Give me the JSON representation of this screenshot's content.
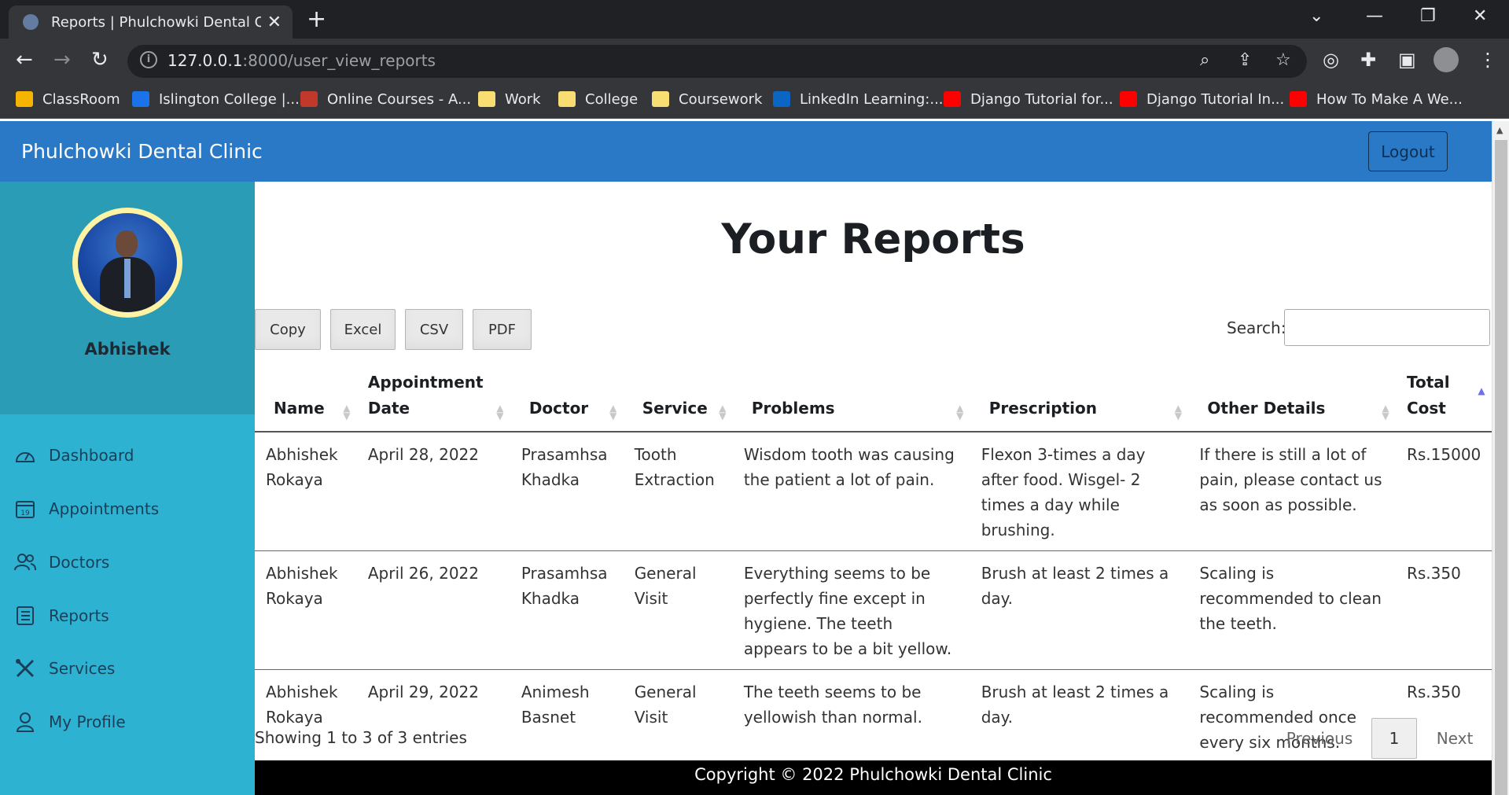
{
  "browser": {
    "tab_title": "Reports | Phulchowki Dental Care",
    "url_host": "127.0.0.1",
    "url_rest": ":8000/user_view_reports",
    "bookmarks": [
      {
        "label": "ClassRoom",
        "color": "#f4b400"
      },
      {
        "label": "Islington College |...",
        "color": "#1a73e8"
      },
      {
        "label": "Online Courses - A...",
        "color": "#c0392b"
      },
      {
        "label": "Work",
        "color": "#f7dd72"
      },
      {
        "label": "College",
        "color": "#f7dd72"
      },
      {
        "label": "Coursework",
        "color": "#f7dd72"
      },
      {
        "label": "LinkedIn Learning:...",
        "color": "#0a66c2"
      },
      {
        "label": "Django Tutorial for...",
        "color": "#ff0000"
      },
      {
        "label": "Django Tutorial In...",
        "color": "#ff0000"
      },
      {
        "label": "How To Make A We...",
        "color": "#ff0000"
      }
    ]
  },
  "navbar": {
    "brand": "Phulchowki Dental Clinic",
    "logout_label": "Logout",
    "color": "#2979c7"
  },
  "sidebar": {
    "username": "Abhishek",
    "items": [
      {
        "label": "Dashboard",
        "icon": "dashboard-icon"
      },
      {
        "label": "Appointments",
        "icon": "calendar-icon"
      },
      {
        "label": "Doctors",
        "icon": "people-icon"
      },
      {
        "label": "Reports",
        "icon": "report-icon"
      },
      {
        "label": "Services",
        "icon": "tools-icon"
      },
      {
        "label": "My Profile",
        "icon": "user-icon"
      }
    ]
  },
  "main": {
    "title": "Your Reports",
    "export_buttons": [
      "Copy",
      "Excel",
      "CSV",
      "PDF"
    ],
    "search_label": "Search:",
    "search_value": "",
    "columns": [
      "Name",
      "Appointment Date",
      "Doctor",
      "Service",
      "Problems",
      "Prescription",
      "Other Details",
      "Total Cost"
    ],
    "rows": [
      [
        "Abhishek Rokaya",
        "April 28, 2022",
        "Prasamhsa Khadka",
        "Tooth Extraction",
        "Wisdom tooth was causing the patient a lot of pain.",
        "Flexon 3-times a day after food. Wisgel- 2 times a day while brushing.",
        "If there is still a lot of pain, please contact us as soon as possible.",
        "Rs.15000"
      ],
      [
        "Abhishek Rokaya",
        "April 26, 2022",
        "Prasamhsa Khadka",
        "General Visit",
        "Everything seems to be perfectly fine except in hygiene. The teeth appears to be a bit yellow.",
        "Brush at least 2 times a day.",
        "Scaling is recommended to clean the teeth.",
        "Rs.350"
      ],
      [
        "Abhishek Rokaya",
        "April 29, 2022",
        "Animesh Basnet",
        "General Visit",
        "The teeth seems to be yellowish than normal.",
        "Brush at least 2 times a day.",
        "Scaling is recommended once every six months.",
        "Rs.350"
      ]
    ],
    "info": "Showing 1 to 3 of 3 entries",
    "pagination": {
      "previous": "Previous",
      "current": "1",
      "next": "Next"
    }
  },
  "footer": {
    "text": "Copyright © 2022 Phulchowki Dental Clinic"
  }
}
